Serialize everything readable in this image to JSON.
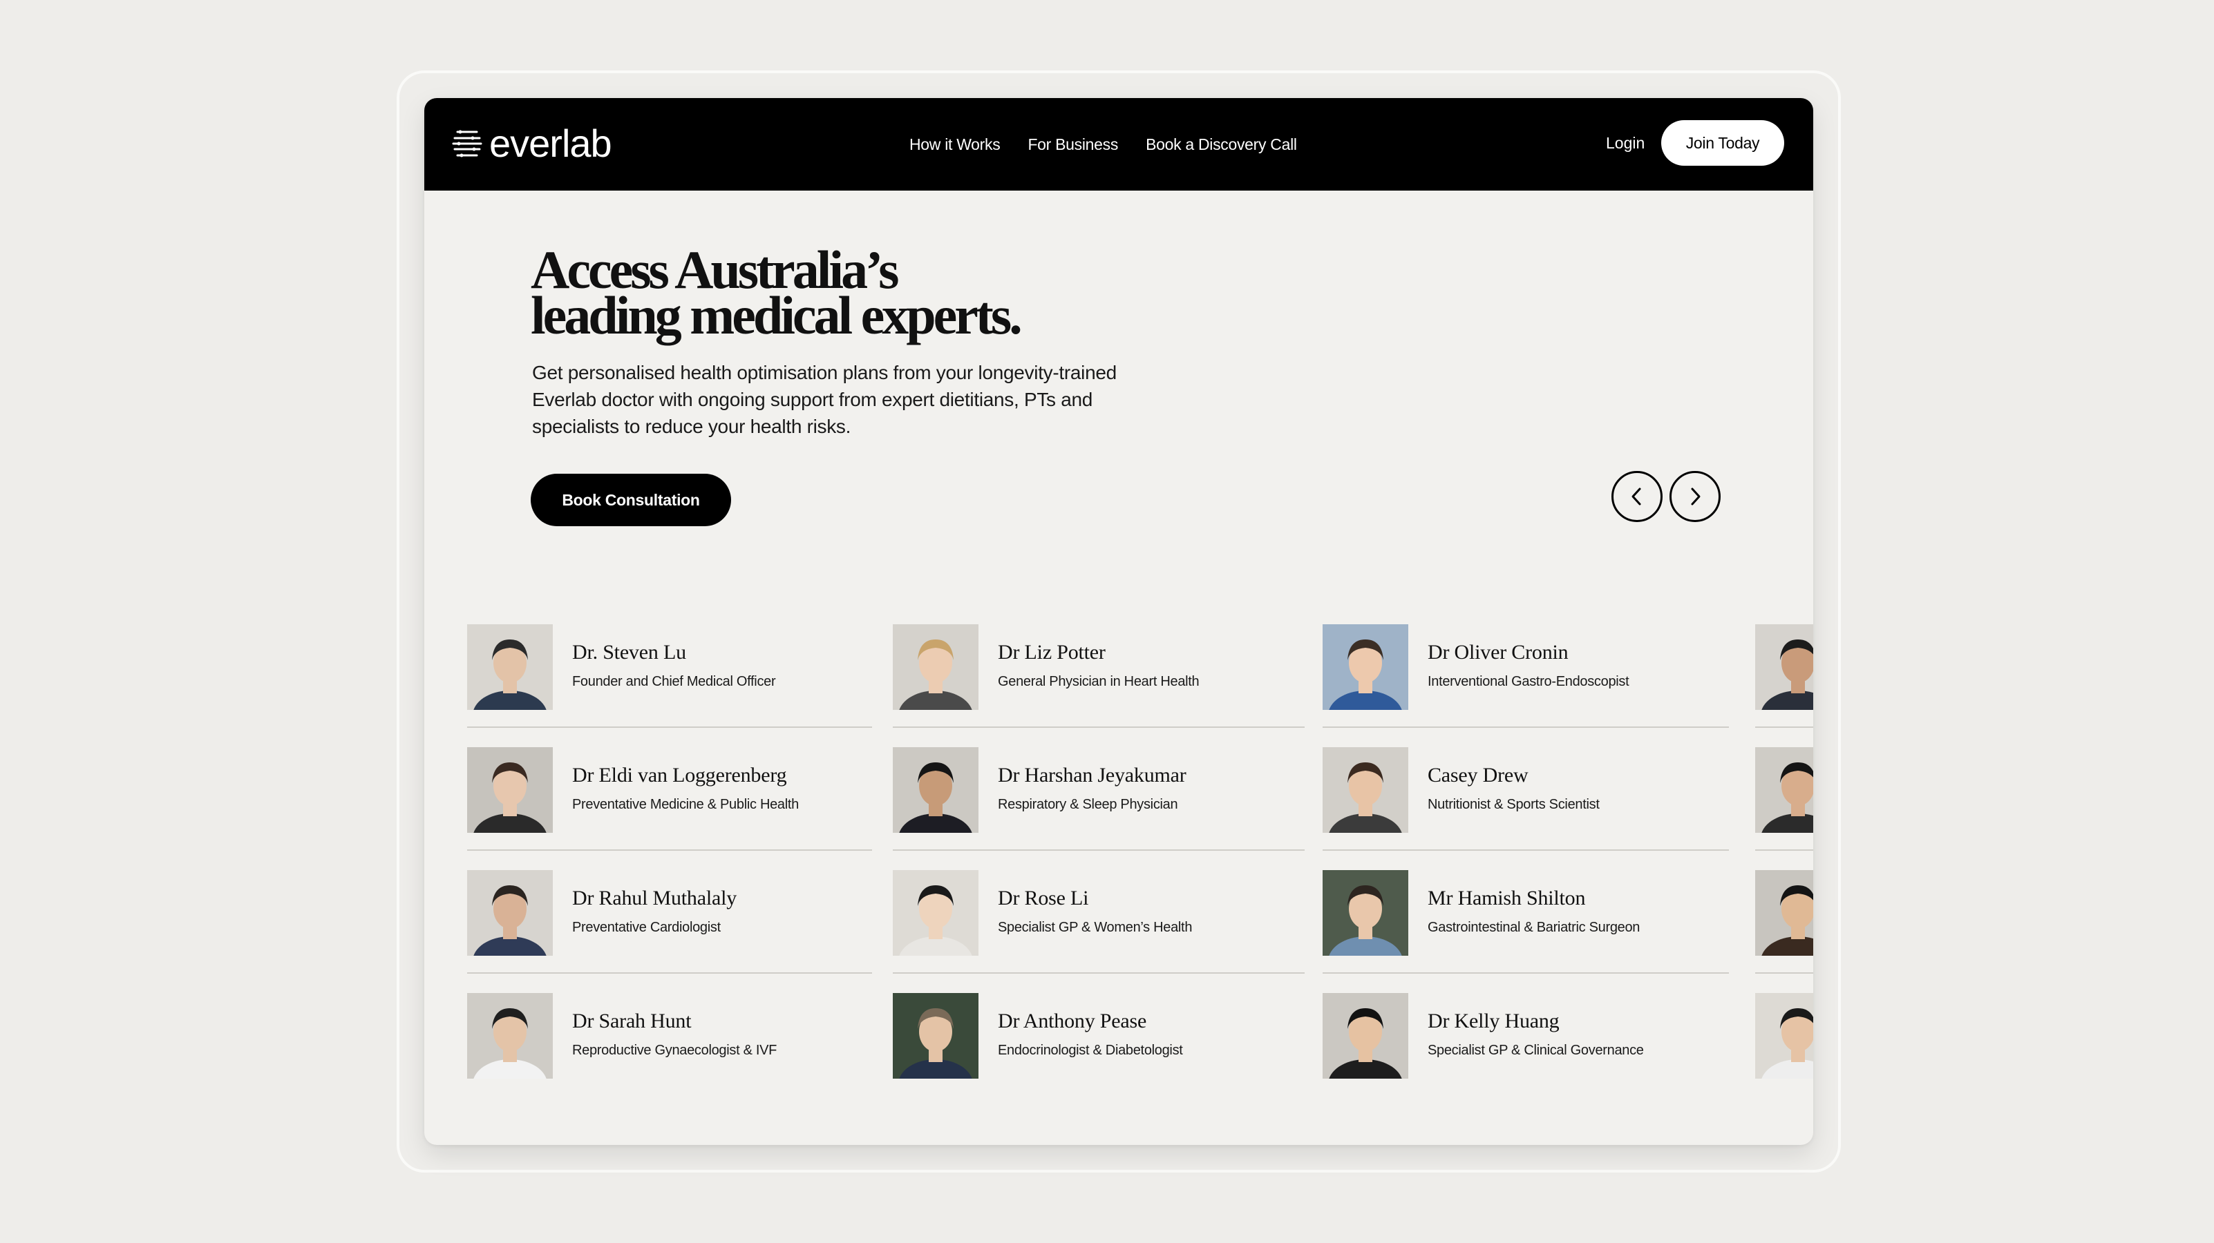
{
  "brand": {
    "logo_text": "everlab"
  },
  "nav": {
    "links": [
      "How it Works",
      "For Business",
      "Book a Discovery Call"
    ],
    "login_label": "Login",
    "join_label": "Join Today"
  },
  "hero": {
    "title_line1": "Access Australia’s",
    "title_line2": "leading medical experts.",
    "description": "Get personalised health optimisation plans from your longevity-trained Everlab doctor with ongoing support from expert dietitians, PTs and specialists to reduce your health risks.",
    "cta_label": "Book Consultation"
  },
  "carousel": {
    "prev_icon": "chevron-left-icon",
    "next_icon": "chevron-right-icon"
  },
  "doctors": [
    [
      {
        "name": "Dr. Steven Lu",
        "role": "Founder and Chief Medical Officer"
      },
      {
        "name": "Dr Eldi van Loggerenberg",
        "role": "Preventative Medicine & Public Health"
      },
      {
        "name": "Dr Rahul Muthalaly",
        "role": "Preventative Cardiologist"
      },
      {
        "name": "Dr Sarah Hunt",
        "role": "Reproductive Gynaecologist & IVF"
      }
    ],
    [
      {
        "name": "Dr Liz Potter",
        "role": "General Physician in Heart Health"
      },
      {
        "name": "Dr Harshan Jeyakumar",
        "role": "Respiratory & Sleep Physician"
      },
      {
        "name": "Dr Rose Li",
        "role": "Specialist GP & Women’s Health"
      },
      {
        "name": "Dr Anthony Pease",
        "role": "Endocrinologist & Diabetologist"
      }
    ],
    [
      {
        "name": "Dr Oliver Cronin",
        "role": "Interventional Gastro-Endoscopist"
      },
      {
        "name": "Casey Drew",
        "role": "Nutritionist & Sports Scientist"
      },
      {
        "name": "Mr Hamish Shilton",
        "role": "Gastrointestinal & Bariatric Surgeon"
      },
      {
        "name": "Dr Kelly Huang",
        "role": "Specialist GP & Clinical Governance"
      }
    ]
  ]
}
